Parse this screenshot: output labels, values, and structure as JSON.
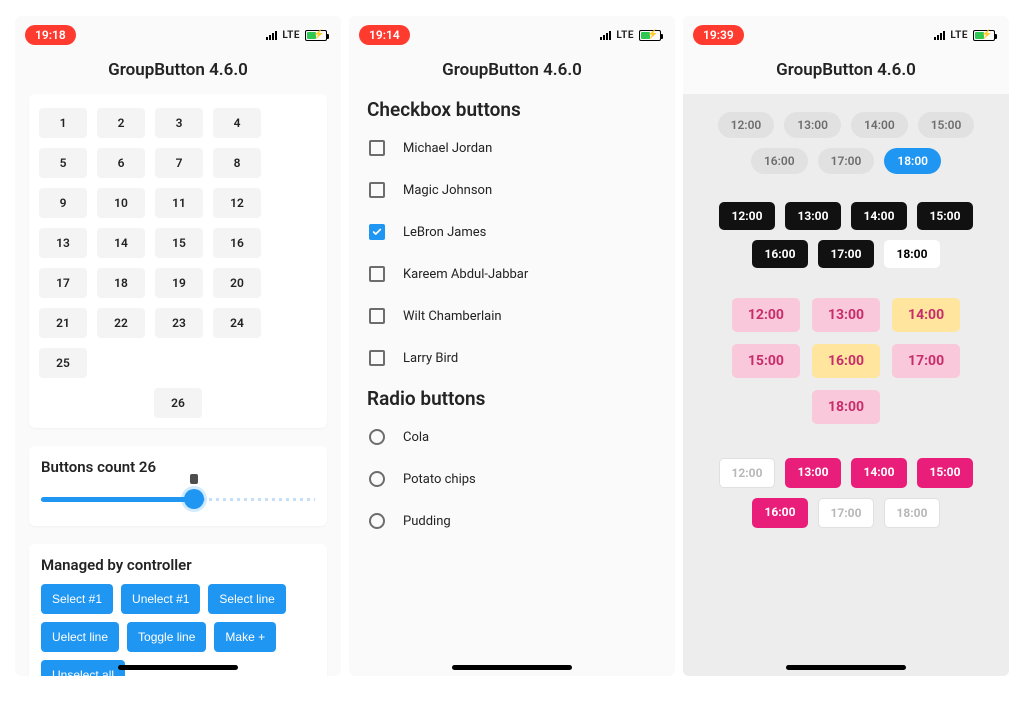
{
  "app_title": "GroupButton 4.6.0",
  "status": {
    "lte": "LTE"
  },
  "phone1": {
    "time": "19:18",
    "numbers": [
      "1",
      "2",
      "3",
      "4",
      "5",
      "6",
      "7",
      "8",
      "9",
      "10",
      "11",
      "12",
      "13",
      "14",
      "15",
      "16",
      "17",
      "18",
      "19",
      "20",
      "21",
      "22",
      "23",
      "24",
      "25",
      "26"
    ],
    "slider": {
      "title": "Buttons count 26",
      "value": 26,
      "max": 50
    },
    "controller": {
      "title": "Managed by controller",
      "buttons": [
        "Select #1",
        "Unelect #1",
        "Select line",
        "Uelect line",
        "Toggle line",
        "Make +",
        "Unselect all"
      ]
    }
  },
  "phone2": {
    "time": "19:14",
    "checkbox_title": "Checkbox buttons",
    "checkbox_items": [
      {
        "label": "Michael Jordan",
        "checked": false
      },
      {
        "label": "Magic Johnson",
        "checked": false
      },
      {
        "label": "LeBron James",
        "checked": true
      },
      {
        "label": "Kareem Abdul-Jabbar",
        "checked": false
      },
      {
        "label": "Wilt Chamberlain",
        "checked": false
      },
      {
        "label": "Larry Bird",
        "checked": false
      }
    ],
    "radio_title": "Radio buttons",
    "radio_items": [
      "Cola",
      "Potato chips",
      "Pudding"
    ]
  },
  "phone3": {
    "time": "19:39",
    "group1": [
      {
        "t": "12:00",
        "style": "muted"
      },
      {
        "t": "13:00",
        "style": "muted"
      },
      {
        "t": "14:00",
        "style": "muted"
      },
      {
        "t": "15:00",
        "style": "muted"
      },
      {
        "t": "16:00",
        "style": "muted"
      },
      {
        "t": "17:00",
        "style": "muted"
      },
      {
        "t": "18:00",
        "style": "blue"
      }
    ],
    "group2": [
      {
        "t": "12:00",
        "style": "black"
      },
      {
        "t": "13:00",
        "style": "black"
      },
      {
        "t": "14:00",
        "style": "black"
      },
      {
        "t": "15:00",
        "style": "black"
      },
      {
        "t": "16:00",
        "style": "black"
      },
      {
        "t": "17:00",
        "style": "black"
      },
      {
        "t": "18:00",
        "style": "white"
      }
    ],
    "group3": [
      {
        "t": "12:00",
        "style": "pink"
      },
      {
        "t": "13:00",
        "style": "pink"
      },
      {
        "t": "14:00",
        "style": "yellow"
      },
      {
        "t": "15:00",
        "style": "pink"
      },
      {
        "t": "16:00",
        "style": "yellow"
      },
      {
        "t": "17:00",
        "style": "pink"
      },
      {
        "t": "18:00",
        "style": "pink"
      }
    ],
    "group4": [
      {
        "t": "12:00",
        "style": "outline"
      },
      {
        "t": "13:00",
        "style": "deep"
      },
      {
        "t": "14:00",
        "style": "deep"
      },
      {
        "t": "15:00",
        "style": "deep"
      },
      {
        "t": "16:00",
        "style": "deep"
      },
      {
        "t": "17:00",
        "style": "outline"
      },
      {
        "t": "18:00",
        "style": "outline"
      }
    ]
  }
}
